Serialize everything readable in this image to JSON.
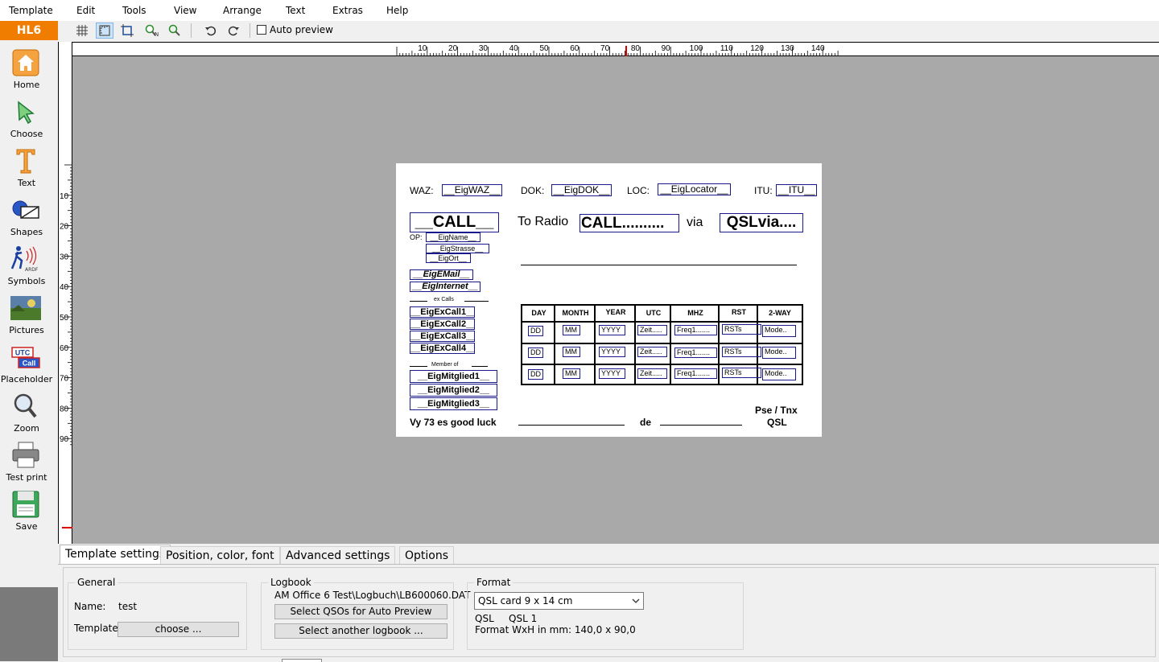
{
  "menu": [
    "Template",
    "Edit",
    "Tools",
    "View",
    "Arrange",
    "Text",
    "Extras",
    "Help"
  ],
  "app_badge": "HL6",
  "toolbar": {
    "auto_preview_label": "Auto preview"
  },
  "sidebar": [
    "Home",
    "Choose",
    "Text",
    "Shapes",
    "Symbols",
    "Pictures",
    "Placeholder",
    "Zoom",
    "Test print",
    "Save"
  ],
  "sidebar_icon_text": {
    "utc": "UTC",
    "call": "Call",
    "ardf": "ARDF"
  },
  "ruler": {
    "h_ticks": [
      "10",
      "20",
      "30",
      "40",
      "50",
      "60",
      "70",
      "80",
      "90",
      "100",
      "110",
      "120",
      "130",
      "140"
    ],
    "v_ticks": [
      "10",
      "20",
      "30",
      "40",
      "50",
      "60",
      "70",
      "80",
      "90"
    ]
  },
  "card": {
    "waz_label": "WAZ:",
    "waz_field": "__EigWAZ__",
    "dok_label": "DOK:",
    "dok_field": "__EigDOK__",
    "loc_label": "LOC:",
    "loc_field": "__EigLocator__",
    "itu_label": "ITU:",
    "itu_field": "__ITU__",
    "call_field": "__CALL__",
    "to_radio": "To Radio",
    "call_dots": "CALL..........",
    "via": "via",
    "qslvia": "QSLvia....",
    "op_label": "OP:",
    "name_field": "__EigName__",
    "strasse_field": "__EigStrasse__",
    "ort_field": "__EigOrt__",
    "email_field": "__EigEMail__",
    "internet_field": "__EigInternet__",
    "ex_calls_label": "ex Calls",
    "ex_calls": [
      "__EigExCall1__",
      "__EigExCall2__",
      "__EigExCall3__",
      "__EigExCall4__"
    ],
    "member_label": "Member of",
    "members": [
      "__EigMitglied1__",
      "__EigMitglied2__",
      "__EigMitglied3__"
    ],
    "qso_headers": [
      "DAY",
      "MONTH",
      "YEAR",
      "UTC",
      "MHZ",
      "RST",
      "2-WAY"
    ],
    "qso_rows": [
      [
        "DD",
        "MM",
        "YYYY",
        "Zeit.....",
        "Freq1.......",
        "RSTs",
        "Mode.."
      ],
      [
        "DD",
        "MM",
        "YYYY",
        "Zeit.....",
        "Freq1.......",
        "RSTs",
        "Mode.."
      ],
      [
        "DD",
        "MM",
        "YYYY",
        "Zeit.....",
        "Freq1.......",
        "RSTs",
        "Mode.."
      ]
    ],
    "pse_tnx": "Pse / Tnx",
    "qsl": "QSL",
    "vy73": "Vy 73 es good luck",
    "de": "de"
  },
  "tabs": [
    "Template settings",
    "Position, color, font",
    "Advanced settings",
    "Options"
  ],
  "general": {
    "title": "General",
    "name_label": "Name:",
    "name_value": "test",
    "template_label": "Template:",
    "choose_button": "choose ..."
  },
  "logbook": {
    "title": "Logbook",
    "path": "AM Office 6 Test\\Logbuch\\LB600060.DAT",
    "select_qsos_button": "Select QSOs for Auto Preview",
    "select_logbook_button": "Select another logbook ..."
  },
  "format": {
    "title": "Format",
    "selected": "QSL card 9 x 14 cm",
    "type_label": "QSL",
    "type_value": "QSL 1",
    "size_label": "Format WxH in mm: 140,0 x 90,0"
  },
  "colors": {
    "accent": "#f07d00",
    "canvas": "#a9a9a9",
    "field_border": "#1a1a8c"
  }
}
